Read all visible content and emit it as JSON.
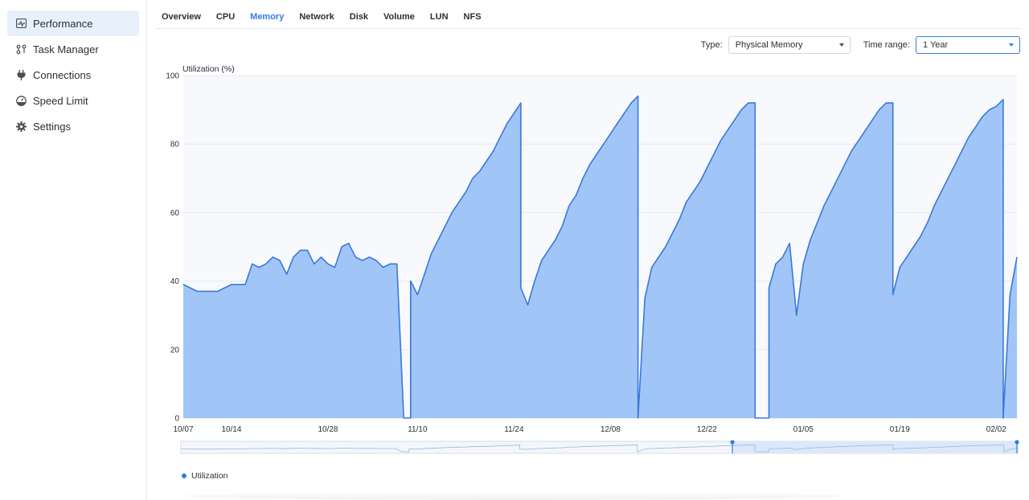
{
  "sidebar": {
    "items": [
      {
        "label": "Performance",
        "icon": "performance-icon",
        "active": true
      },
      {
        "label": "Task Manager",
        "icon": "task-manager-icon",
        "active": false
      },
      {
        "label": "Connections",
        "icon": "plug-icon",
        "active": false
      },
      {
        "label": "Speed Limit",
        "icon": "gauge-icon",
        "active": false
      },
      {
        "label": "Settings",
        "icon": "gear-icon",
        "active": false
      }
    ]
  },
  "tabs": [
    "Overview",
    "CPU",
    "Memory",
    "Network",
    "Disk",
    "Volume",
    "LUN",
    "NFS"
  ],
  "active_tab": "Memory",
  "toolbar": {
    "type_label": "Type:",
    "type_value": "Physical Memory",
    "range_label": "Time range:",
    "range_value": "1 Year"
  },
  "legend": {
    "label": "Utilization"
  },
  "colors": {
    "accent": "#2f7fde",
    "area_fill": "#9cc2f5",
    "line": "#3a78dd"
  },
  "chart_data": {
    "type": "area",
    "ylabel": "Utilization (%)",
    "ylim": [
      0,
      100
    ],
    "yticks": [
      0,
      20,
      40,
      60,
      80,
      100
    ],
    "xlim": [
      "2023-10-07",
      "2024-02-05"
    ],
    "xticks": [
      "10/07",
      "10/14",
      "10/28",
      "11/10",
      "11/24",
      "12/08",
      "12/22",
      "01/05",
      "01/19",
      "02/02"
    ],
    "grid": true,
    "legend_position": "bottom-left",
    "series": [
      {
        "name": "Utilization",
        "points": [
          [
            "2023-10-07",
            39
          ],
          [
            "2023-10-08",
            38
          ],
          [
            "2023-10-09",
            37
          ],
          [
            "2023-10-10",
            37
          ],
          [
            "2023-10-11",
            37
          ],
          [
            "2023-10-12",
            37
          ],
          [
            "2023-10-13",
            38
          ],
          [
            "2023-10-14",
            39
          ],
          [
            "2023-10-16",
            39
          ],
          [
            "2023-10-17",
            45
          ],
          [
            "2023-10-18",
            44
          ],
          [
            "2023-10-19",
            45
          ],
          [
            "2023-10-20",
            47
          ],
          [
            "2023-10-21",
            46
          ],
          [
            "2023-10-22",
            42
          ],
          [
            "2023-10-23",
            47
          ],
          [
            "2023-10-24",
            49
          ],
          [
            "2023-10-25",
            49
          ],
          [
            "2023-10-26",
            45
          ],
          [
            "2023-10-27",
            47
          ],
          [
            "2023-10-28",
            45
          ],
          [
            "2023-10-29",
            44
          ],
          [
            "2023-10-30",
            50
          ],
          [
            "2023-10-31",
            51
          ],
          [
            "2023-11-01",
            47
          ],
          [
            "2023-11-02",
            46
          ],
          [
            "2023-11-03",
            47
          ],
          [
            "2023-11-04",
            46
          ],
          [
            "2023-11-05",
            44
          ],
          [
            "2023-11-06",
            45
          ],
          [
            "2023-11-07",
            45
          ],
          [
            "2023-11-08",
            0
          ],
          [
            "2023-11-09",
            0
          ],
          [
            "2023-11-09",
            40
          ],
          [
            "2023-11-10",
            36
          ],
          [
            "2023-11-11",
            42
          ],
          [
            "2023-11-12",
            48
          ],
          [
            "2023-11-13",
            52
          ],
          [
            "2023-11-14",
            56
          ],
          [
            "2023-11-15",
            60
          ],
          [
            "2023-11-16",
            63
          ],
          [
            "2023-11-17",
            66
          ],
          [
            "2023-11-18",
            70
          ],
          [
            "2023-11-19",
            72
          ],
          [
            "2023-11-20",
            75
          ],
          [
            "2023-11-21",
            78
          ],
          [
            "2023-11-22",
            82
          ],
          [
            "2023-11-23",
            86
          ],
          [
            "2023-11-24",
            89
          ],
          [
            "2023-11-25",
            92
          ],
          [
            "2023-11-25",
            38
          ],
          [
            "2023-11-26",
            33
          ],
          [
            "2023-11-27",
            40
          ],
          [
            "2023-11-28",
            46
          ],
          [
            "2023-11-29",
            49
          ],
          [
            "2023-11-30",
            52
          ],
          [
            "2023-12-01",
            56
          ],
          [
            "2023-12-02",
            62
          ],
          [
            "2023-12-03",
            65
          ],
          [
            "2023-12-04",
            70
          ],
          [
            "2023-12-05",
            74
          ],
          [
            "2023-12-06",
            77
          ],
          [
            "2023-12-07",
            80
          ],
          [
            "2023-12-08",
            83
          ],
          [
            "2023-12-09",
            86
          ],
          [
            "2023-12-10",
            89
          ],
          [
            "2023-12-11",
            92
          ],
          [
            "2023-12-12",
            94
          ],
          [
            "2023-12-12",
            0
          ],
          [
            "2023-12-13",
            35
          ],
          [
            "2023-12-14",
            44
          ],
          [
            "2023-12-15",
            47
          ],
          [
            "2023-12-16",
            50
          ],
          [
            "2023-12-17",
            54
          ],
          [
            "2023-12-18",
            58
          ],
          [
            "2023-12-19",
            63
          ],
          [
            "2023-12-20",
            66
          ],
          [
            "2023-12-21",
            69
          ],
          [
            "2023-12-22",
            73
          ],
          [
            "2023-12-23",
            77
          ],
          [
            "2023-12-24",
            81
          ],
          [
            "2023-12-25",
            84
          ],
          [
            "2023-12-26",
            87
          ],
          [
            "2023-12-27",
            90
          ],
          [
            "2023-12-28",
            92
          ],
          [
            "2023-12-29",
            92
          ],
          [
            "2023-12-29",
            0
          ],
          [
            "2023-12-31",
            0
          ],
          [
            "2023-12-31",
            38
          ],
          [
            "2024-01-01",
            45
          ],
          [
            "2024-01-02",
            47
          ],
          [
            "2024-01-03",
            51
          ],
          [
            "2024-01-04",
            30
          ],
          [
            "2024-01-05",
            45
          ],
          [
            "2024-01-06",
            52
          ],
          [
            "2024-01-07",
            57
          ],
          [
            "2024-01-08",
            62
          ],
          [
            "2024-01-09",
            66
          ],
          [
            "2024-01-10",
            70
          ],
          [
            "2024-01-11",
            74
          ],
          [
            "2024-01-12",
            78
          ],
          [
            "2024-01-13",
            81
          ],
          [
            "2024-01-14",
            84
          ],
          [
            "2024-01-15",
            87
          ],
          [
            "2024-01-16",
            90
          ],
          [
            "2024-01-17",
            92
          ],
          [
            "2024-01-18",
            92
          ],
          [
            "2024-01-18",
            36
          ],
          [
            "2024-01-19",
            44
          ],
          [
            "2024-01-20",
            47
          ],
          [
            "2024-01-21",
            50
          ],
          [
            "2024-01-22",
            53
          ],
          [
            "2024-01-23",
            57
          ],
          [
            "2024-01-24",
            62
          ],
          [
            "2024-01-25",
            66
          ],
          [
            "2024-01-26",
            70
          ],
          [
            "2024-01-27",
            74
          ],
          [
            "2024-01-28",
            78
          ],
          [
            "2024-01-29",
            82
          ],
          [
            "2024-01-30",
            85
          ],
          [
            "2024-01-31",
            88
          ],
          [
            "2024-02-01",
            90
          ],
          [
            "2024-02-02",
            91
          ],
          [
            "2024-02-03",
            93
          ],
          [
            "2024-02-03",
            0
          ],
          [
            "2024-02-04",
            36
          ],
          [
            "2024-02-05",
            47
          ]
        ]
      }
    ]
  }
}
